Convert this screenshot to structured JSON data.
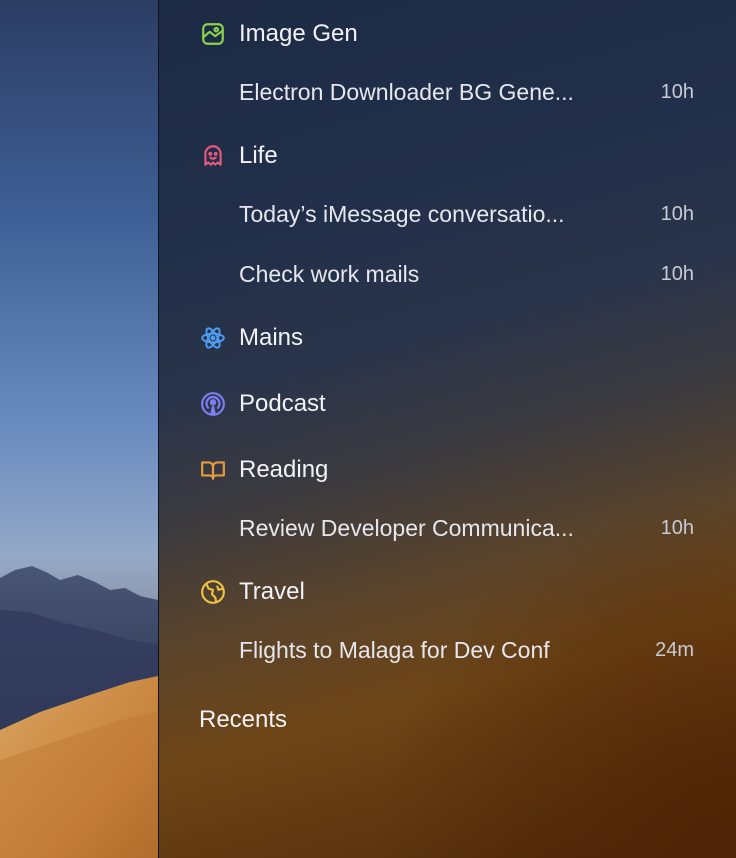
{
  "sidebar": {
    "groups": [
      {
        "label": "Image Gen",
        "icon": "image-gen-icon",
        "color": "#8bd34a",
        "items": [
          {
            "title": "Electron Downloader BG Gene...",
            "time": "10h"
          }
        ]
      },
      {
        "label": "Life",
        "icon": "ghost-icon",
        "color": "#e8587a",
        "items": [
          {
            "title": "Today’s iMessage conversatio...",
            "time": "10h"
          },
          {
            "title": "Check work mails",
            "time": "10h"
          }
        ]
      },
      {
        "label": "Mains",
        "icon": "atom-icon",
        "color": "#4d9ef0",
        "items": []
      },
      {
        "label": "Podcast",
        "icon": "podcast-icon",
        "color": "#7b7ff0",
        "items": []
      },
      {
        "label": "Reading",
        "icon": "book-icon",
        "color": "#e89a3c",
        "items": [
          {
            "title": "Review Developer Communica...",
            "time": "10h"
          }
        ]
      },
      {
        "label": "Travel",
        "icon": "globe-icon",
        "color": "#f0c040",
        "items": [
          {
            "title": "Flights to Malaga for Dev Conf",
            "time": "24m"
          }
        ]
      }
    ],
    "recents_label": "Recents"
  }
}
